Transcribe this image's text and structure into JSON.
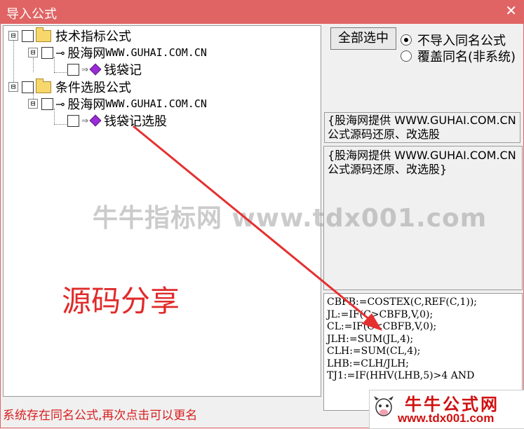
{
  "window": {
    "title": "导入公式",
    "close_icon": "close-icon"
  },
  "tree": {
    "group1": {
      "label": "技术指标公式",
      "expander": "⊟"
    },
    "group1_author": {
      "label_cn": "股海网",
      "label_en": "WWW.GUHAI.COM.CN",
      "expander": "⊟"
    },
    "group1_item": {
      "label": "钱袋记"
    },
    "group2": {
      "label": "条件选股公式",
      "expander": "⊟"
    },
    "group2_author": {
      "label_cn": "股海网",
      "label_en": "WWW.GUHAI.COM.CN",
      "expander": "⊟"
    },
    "group2_item": {
      "label": "钱袋记选股"
    }
  },
  "controls": {
    "select_all": "全部选中",
    "radio_no_import": "不导入同名公式",
    "radio_overwrite": "覆盖同名(非系统)",
    "radio_selected": "no_import"
  },
  "info": {
    "box1": "{股海网提供 WWW.GUHAI.COM.CN 公式源码还原、改选股",
    "box2_line1": "{股海网提供 WWW.GUHAI.COM.CN",
    "box2_line2": "公式源码还原、改选股}"
  },
  "code_lines": [
    "CBFB:=COSTEX(C,REF(C,1));",
    "JL:=IF(C>CBFB,V,0);",
    "CL:=IF(C<CBFB,V,0);",
    "JLH:=SUM(JL,4);",
    "CLH:=SUM(CL,4);",
    "LHB:=CLH/JLH;",
    "TJ1:=IF(HHV(LHB,5)>4 AND"
  ],
  "status": "系统存在同名公式,再次点击可以更名",
  "overlay": {
    "watermark": "牛牛指标网 www.tdx001.com",
    "share": "源码分享",
    "logo_title": "牛牛公式网",
    "logo_url": "www.tdx001.com",
    "arrow_color": "#e53030"
  }
}
